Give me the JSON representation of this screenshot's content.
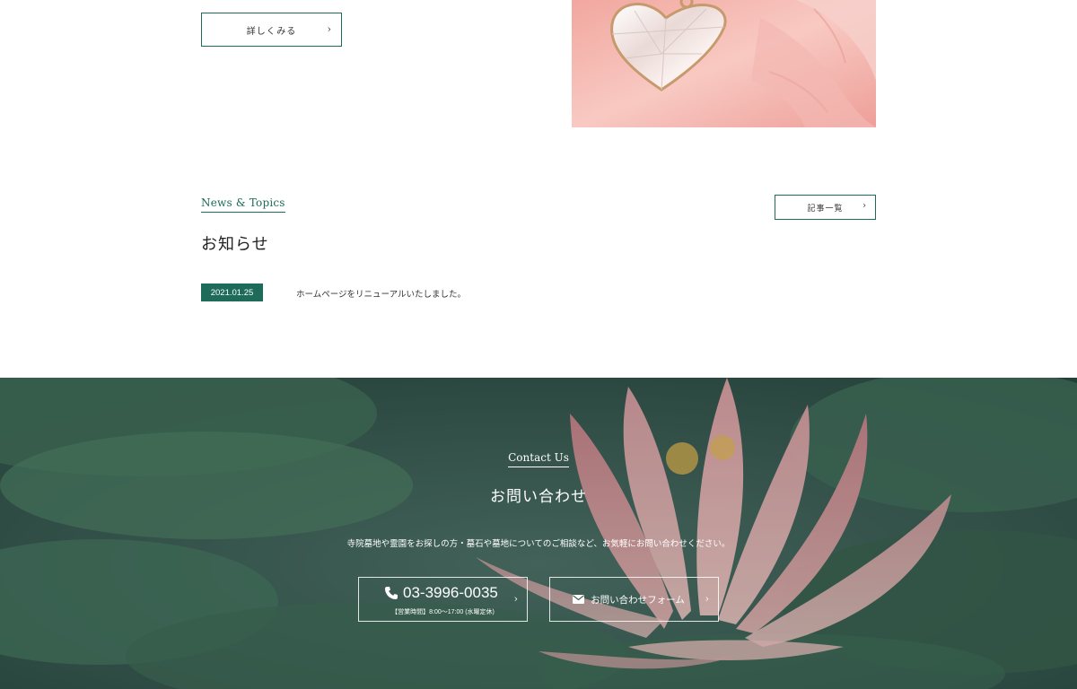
{
  "top": {
    "more_label": "詳しくみる",
    "chevron": "›",
    "image_icon": "heart-pendant-photo"
  },
  "news": {
    "eyebrow": "News & Topics",
    "title": "お知らせ",
    "all_label": "記事一覧",
    "items": [
      {
        "date": "2021.01.25",
        "text": "ホームページをリニューアルいたしました。"
      }
    ]
  },
  "contact": {
    "eyebrow": "Contact Us",
    "title": "お問い合わせ",
    "description": "寺院墓地や霊園をお探しの方・墓石や墓地についてのご相談など、お気軽にお問い合わせください。",
    "tel": "03-3996-0035",
    "hours": "【営業時間】8:00～17:00 (水曜定休)",
    "form_label": "お問い合わせフォーム",
    "tel_icon": "phone-icon",
    "form_icon": "envelope-icon",
    "background_icon": "lotus-photo"
  },
  "colors": {
    "accent": "#1f6b5a",
    "white": "#ffffff"
  }
}
